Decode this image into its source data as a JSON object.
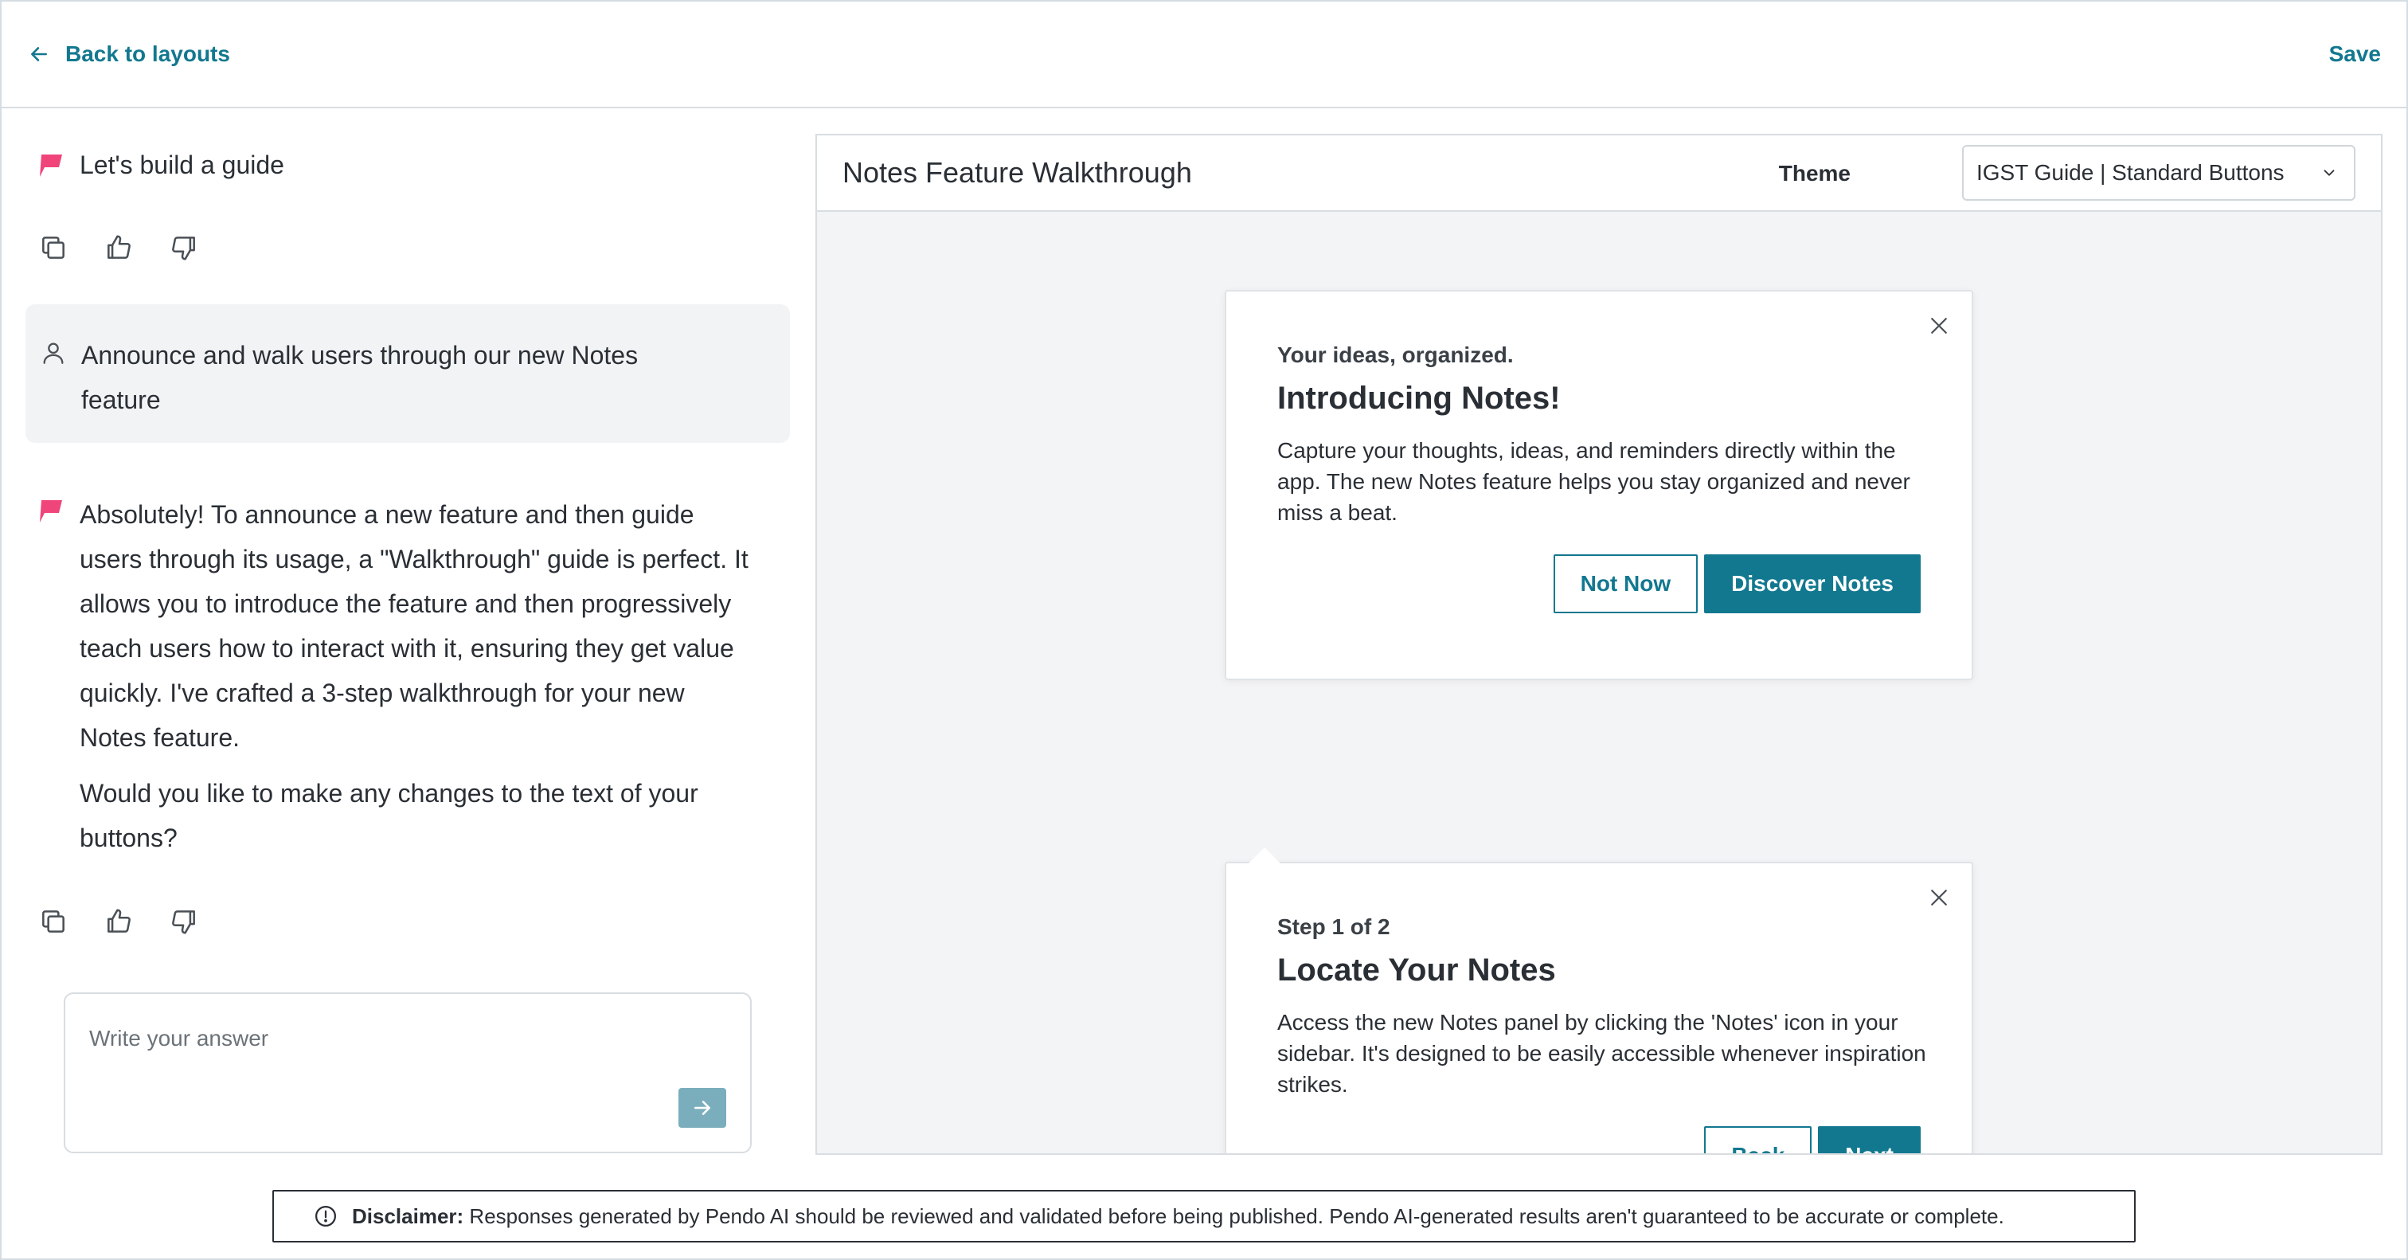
{
  "topbar": {
    "back_label": "Back to layouts",
    "save_label": "Save"
  },
  "chat": {
    "messages": [
      {
        "role": "ai",
        "paragraphs": [
          "Let's build a guide"
        ]
      },
      {
        "role": "user",
        "text": "Announce and walk users through our new Notes feature"
      },
      {
        "role": "ai",
        "paragraphs": [
          "Absolutely! To announce a new feature and then guide users through its usage, a \"Walkthrough\" guide is perfect. It allows you to introduce the feature and then progressively teach users how to interact with it, ensuring they get value quickly. I've crafted a 3-step walkthrough for your new Notes feature.",
          "Would you like to make any changes to the text of your buttons?"
        ]
      }
    ],
    "input_placeholder": "Write your answer"
  },
  "preview": {
    "title": "Notes Feature Walkthrough",
    "theme_label": "Theme",
    "theme_value": "IGST Guide | Standard Buttons",
    "cards": [
      {
        "eyebrow": "Your ideas, organized.",
        "title": "Introducing Notes!",
        "body": "Capture your thoughts, ideas, and reminders directly within the app. The new Notes feature helps you stay organized and never miss a beat.",
        "secondary_button": "Not Now",
        "primary_button": "Discover Notes"
      },
      {
        "eyebrow": "Step 1 of 2",
        "title": "Locate Your Notes",
        "body": "Access the new Notes panel by clicking the 'Notes' icon in your sidebar. It's designed to be easily accessible whenever inspiration strikes.",
        "secondary_button": "Back",
        "primary_button": "Next"
      }
    ]
  },
  "disclaimer": {
    "label": "Disclaimer:",
    "text": "Responses generated by Pendo AI should be reviewed and validated before being published. Pendo AI-generated results aren't guaranteed to be accurate or complete."
  },
  "colors": {
    "accent": "#12788f",
    "ai_logo": "#f0457a",
    "preview_bg": "#f3f4f6",
    "user_bubble": "#f2f3f5"
  },
  "icons": {
    "back": "arrow-left-icon",
    "ai": "pendo-logo-icon",
    "copy": "copy-icon",
    "like": "thumbs-up-icon",
    "dislike": "thumbs-down-icon",
    "user": "user-icon",
    "send": "arrow-right-icon",
    "close": "close-icon",
    "dropdown": "chevron-down-icon",
    "info": "info-circle-icon"
  }
}
